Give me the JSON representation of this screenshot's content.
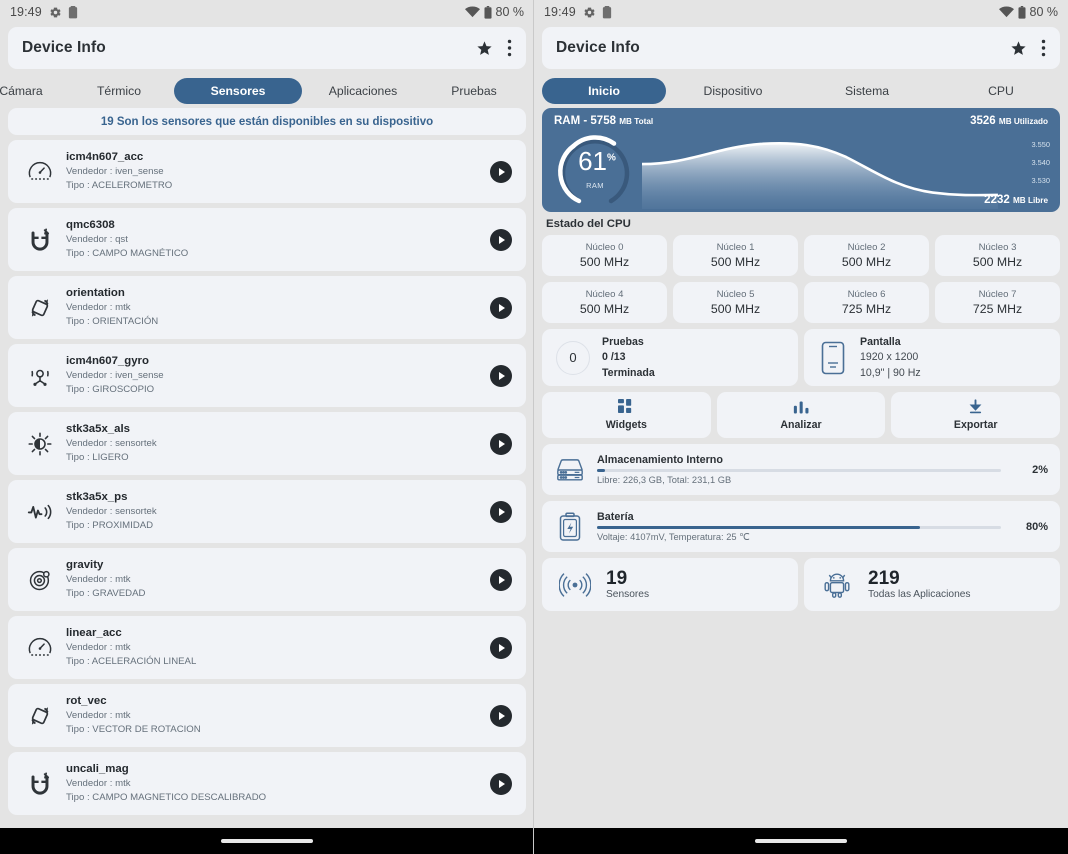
{
  "status_bar": {
    "time": "19:49",
    "battery_text": "80 %",
    "icons": [
      "gear-icon",
      "clipboard-icon",
      "wifi-icon",
      "battery-icon"
    ]
  },
  "app": {
    "title": "Device Info",
    "star_label": "★",
    "overflow_label": "⋮"
  },
  "colors": {
    "accent": "#39648f",
    "ram_card": "#4a6f96",
    "card_bg": "#f1f3f7",
    "page_bg": "#e4e4e4",
    "icon_blue": "#4a6f96"
  },
  "left_panel": {
    "tabs": [
      {
        "label": "Cámara",
        "selected": false
      },
      {
        "label": "Térmico",
        "selected": false
      },
      {
        "label": "Sensores",
        "selected": true
      },
      {
        "label": "Aplicaciones",
        "selected": false
      },
      {
        "label": "Pruebas",
        "selected": false
      }
    ],
    "notice": "19 Son los sensores que están disponibles en su dispositivo",
    "vendor_label": "Vendedor :",
    "type_label": "Tipo :",
    "sensors": [
      {
        "name": "icm4n607_acc",
        "vendor": "Vendedor : iven_sense",
        "type": "Tipo : ACELEROMETRO",
        "icon": "speedometer-icon"
      },
      {
        "name": "qmc6308",
        "vendor": "Vendedor : qst",
        "type": "Tipo : CAMPO MAGNÉTICO",
        "icon": "magnet-icon"
      },
      {
        "name": "orientation",
        "vendor": "Vendedor : mtk",
        "type": "Tipo : ORIENTACIÓN",
        "icon": "rotate-icon"
      },
      {
        "name": "icm4n607_gyro",
        "vendor": "Vendedor : iven_sense",
        "type": "Tipo : GIROSCOPIO",
        "icon": "gyroscope-icon"
      },
      {
        "name": "stk3a5x_als",
        "vendor": "Vendedor : sensortek",
        "type": "Tipo : LIGERO",
        "icon": "brightness-icon"
      },
      {
        "name": "stk3a5x_ps",
        "vendor": "Vendedor : sensortek",
        "type": "Tipo : PROXIMIDAD",
        "icon": "proximity-icon"
      },
      {
        "name": "gravity",
        "vendor": "Vendedor : mtk",
        "type": "Tipo : GRAVEDAD",
        "icon": "gravity-icon"
      },
      {
        "name": "linear_acc",
        "vendor": "Vendedor : mtk",
        "type": "Tipo : ACELERACIÓN LINEAL",
        "icon": "speedometer-icon"
      },
      {
        "name": "rot_vec",
        "vendor": "Vendedor : mtk",
        "type": "Tipo : VECTOR DE ROTACION",
        "icon": "rotate-icon"
      },
      {
        "name": "uncali_mag",
        "vendor": "Vendedor : mtk",
        "type": "Tipo : CAMPO MAGNETICO DESCALIBRADO",
        "icon": "magnet-icon"
      }
    ],
    "play_button_label": "play"
  },
  "right_panel": {
    "tabs": [
      {
        "label": "Inicio",
        "selected": true
      },
      {
        "label": "Dispositivo",
        "selected": false
      },
      {
        "label": "Sistema",
        "selected": false
      },
      {
        "label": "CPU",
        "selected": false
      }
    ],
    "ram": {
      "title_main": "RAM - 5758",
      "title_unit": "MB Total",
      "used_value": "3526",
      "used_unit": "MB Utilizado",
      "free_value": "2232",
      "free_unit": "MB Libre",
      "percent": "61",
      "percent_sign": "%",
      "gauge_caption": "RAM",
      "axis_labels": [
        "3.550",
        "3.540",
        "3.530"
      ]
    },
    "cpu": {
      "section_title": "Estado del CPU",
      "cores": [
        {
          "name": "Núcleo 0",
          "freq": "500 MHz"
        },
        {
          "name": "Núcleo 1",
          "freq": "500 MHz"
        },
        {
          "name": "Núcleo 2",
          "freq": "500 MHz"
        },
        {
          "name": "Núcleo 3",
          "freq": "500 MHz"
        },
        {
          "name": "Núcleo 4",
          "freq": "500 MHz"
        },
        {
          "name": "Núcleo 5",
          "freq": "500 MHz"
        },
        {
          "name": "Núcleo 6",
          "freq": "725 MHz"
        },
        {
          "name": "Núcleo 7",
          "freq": "725 MHz"
        }
      ]
    },
    "tests": {
      "ring_value": "0",
      "title": "Pruebas",
      "count": "0 /13",
      "status": "Terminada"
    },
    "display": {
      "title": "Pantalla",
      "resolution": "1920 x 1200",
      "specs": "10,9\" | 90 Hz",
      "icon": "tablet-icon"
    },
    "actions": [
      {
        "label": "Widgets",
        "icon": "widgets-icon"
      },
      {
        "label": "Analizar",
        "icon": "bar-chart-icon"
      },
      {
        "label": "Exportar",
        "icon": "download-icon"
      }
    ],
    "storage": {
      "title": "Almacenamiento Interno",
      "sub": "Libre: 226,3 GB,  Total: 231,1 GB",
      "percent": "2%",
      "percent_value": 2,
      "icon": "storage-icon"
    },
    "battery": {
      "title": "Batería",
      "sub": "Voltaje: 4107mV,  Temperatura: 25 ℃",
      "percent": "80%",
      "percent_value": 80,
      "icon": "battery-bolt-icon"
    },
    "counts": [
      {
        "number": "19",
        "label": "Sensores",
        "icon": "sensor-waves-icon"
      },
      {
        "number": "219",
        "label": "Todas las Aplicaciones",
        "icon": "android-icon"
      }
    ]
  }
}
